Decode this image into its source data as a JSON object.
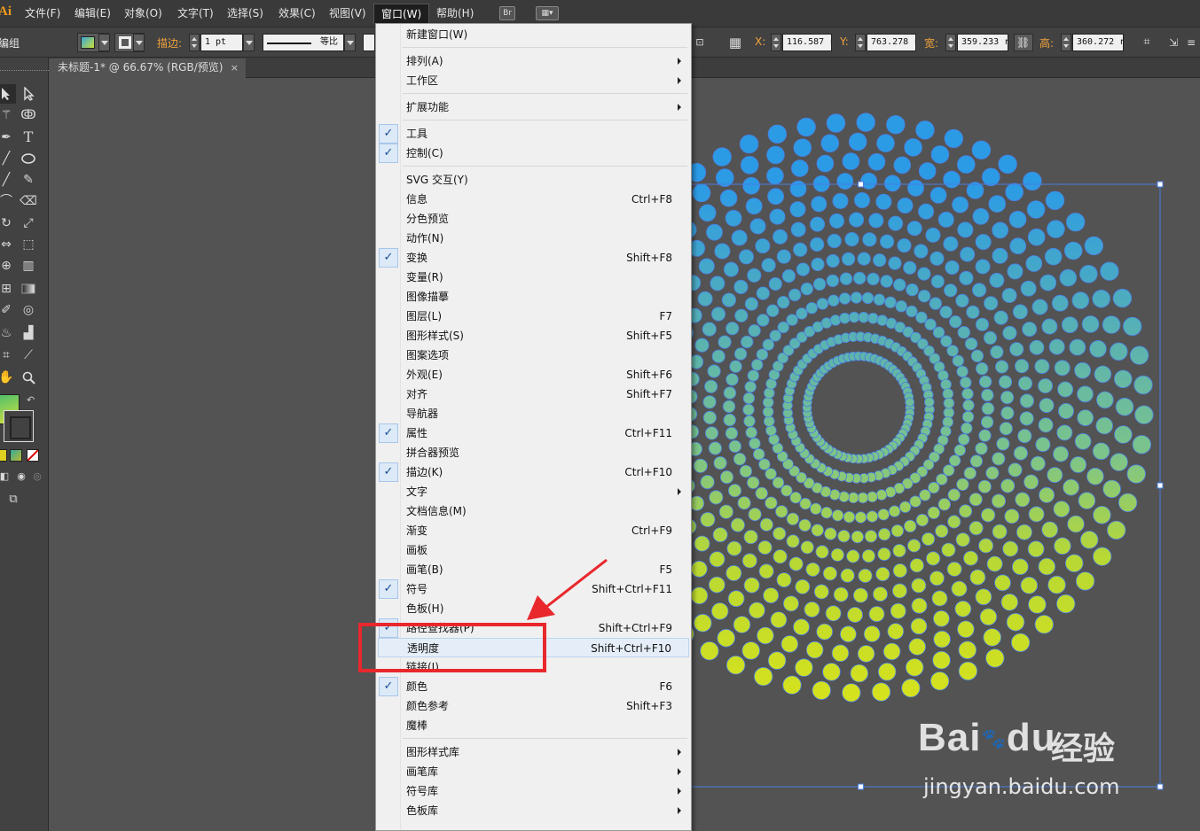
{
  "app": {
    "logo": "Ai",
    "colors": {
      "accent_orange": "#f29b1d",
      "menu_bg": "#f0f0f0",
      "annotation_red": "#e8282d",
      "selection_blue": "#4a7de1"
    }
  },
  "menubar": {
    "items": [
      {
        "label": "文件(F)"
      },
      {
        "label": "编辑(E)"
      },
      {
        "label": "对象(O)"
      },
      {
        "label": "文字(T)"
      },
      {
        "label": "选择(S)"
      },
      {
        "label": "效果(C)"
      },
      {
        "label": "视图(V)"
      },
      {
        "label": "窗口(W)",
        "active": true
      },
      {
        "label": "帮助(H)"
      }
    ],
    "bridge_label": "Br"
  },
  "controlbar": {
    "group_label": "编组",
    "stroke_label": "描边:",
    "stroke_weight": "1 pt",
    "stroke_profile": "等比",
    "x_label": "X:",
    "x_value": "116.587 r",
    "y_label": "Y:",
    "y_value": "763.278 r",
    "w_label": "宽:",
    "w_value": "359.233 r",
    "h_label": "高:",
    "h_value": "360.272 r"
  },
  "document": {
    "tab_title": "未标题-1* @ 66.67% (RGB/预览)",
    "close_glyph": "×"
  },
  "window_menu": {
    "items": [
      {
        "label": "新建窗口(W)",
        "shortcut": "",
        "submenu": false,
        "checked": false
      },
      {
        "sep": true
      },
      {
        "label": "排列(A)",
        "shortcut": "",
        "submenu": true,
        "checked": false
      },
      {
        "label": "工作区",
        "shortcut": "",
        "submenu": true,
        "checked": false
      },
      {
        "sep": true
      },
      {
        "label": "扩展功能",
        "shortcut": "",
        "submenu": true,
        "checked": false
      },
      {
        "sep": true
      },
      {
        "label": "工具",
        "shortcut": "",
        "submenu": false,
        "checked": true
      },
      {
        "label": "控制(C)",
        "shortcut": "",
        "submenu": false,
        "checked": true
      },
      {
        "sep": true
      },
      {
        "label": "SVG 交互(Y)",
        "shortcut": "",
        "submenu": false,
        "checked": false
      },
      {
        "label": "信息",
        "shortcut": "Ctrl+F8",
        "submenu": false,
        "checked": false
      },
      {
        "label": "分色预览",
        "shortcut": "",
        "submenu": false,
        "checked": false
      },
      {
        "label": "动作(N)",
        "shortcut": "",
        "submenu": false,
        "checked": false
      },
      {
        "label": "变换",
        "shortcut": "Shift+F8",
        "submenu": false,
        "checked": true
      },
      {
        "label": "变量(R)",
        "shortcut": "",
        "submenu": false,
        "checked": false
      },
      {
        "label": "图像描摹",
        "shortcut": "",
        "submenu": false,
        "checked": false
      },
      {
        "label": "图层(L)",
        "shortcut": "F7",
        "submenu": false,
        "checked": false
      },
      {
        "label": "图形样式(S)",
        "shortcut": "Shift+F5",
        "submenu": false,
        "checked": false
      },
      {
        "label": "图案选项",
        "shortcut": "",
        "submenu": false,
        "checked": false
      },
      {
        "label": "外观(E)",
        "shortcut": "Shift+F6",
        "submenu": false,
        "checked": false
      },
      {
        "label": "对齐",
        "shortcut": "Shift+F7",
        "submenu": false,
        "checked": false
      },
      {
        "label": "导航器",
        "shortcut": "",
        "submenu": false,
        "checked": false
      },
      {
        "label": "属性",
        "shortcut": "Ctrl+F11",
        "submenu": false,
        "checked": true
      },
      {
        "label": "拼合器预览",
        "shortcut": "",
        "submenu": false,
        "checked": false
      },
      {
        "label": "描边(K)",
        "shortcut": "Ctrl+F10",
        "submenu": false,
        "checked": true
      },
      {
        "label": "文字",
        "shortcut": "",
        "submenu": true,
        "checked": false
      },
      {
        "label": "文档信息(M)",
        "shortcut": "",
        "submenu": false,
        "checked": false
      },
      {
        "label": "渐变",
        "shortcut": "Ctrl+F9",
        "submenu": false,
        "checked": false
      },
      {
        "label": "画板",
        "shortcut": "",
        "submenu": false,
        "checked": false
      },
      {
        "label": "画笔(B)",
        "shortcut": "F5",
        "submenu": false,
        "checked": false
      },
      {
        "label": "符号",
        "shortcut": "Shift+Ctrl+F11",
        "submenu": false,
        "checked": true
      },
      {
        "label": "色板(H)",
        "shortcut": "",
        "submenu": false,
        "checked": false
      },
      {
        "label": "路径查找器(P)",
        "shortcut": "Shift+Ctrl+F9",
        "submenu": false,
        "checked": true
      },
      {
        "label": "透明度",
        "shortcut": "Shift+Ctrl+F10",
        "submenu": false,
        "checked": false,
        "highlighted": true
      },
      {
        "label": "链接(I)",
        "shortcut": "",
        "submenu": false,
        "checked": false
      },
      {
        "label": "颜色",
        "shortcut": "F6",
        "submenu": false,
        "checked": true
      },
      {
        "label": "颜色参考",
        "shortcut": "Shift+F3",
        "submenu": false,
        "checked": false
      },
      {
        "label": "魔棒",
        "shortcut": "",
        "submenu": false,
        "checked": false
      },
      {
        "sep": true
      },
      {
        "label": "图形样式库",
        "shortcut": "",
        "submenu": true,
        "checked": false
      },
      {
        "label": "画笔库",
        "shortcut": "",
        "submenu": true,
        "checked": false
      },
      {
        "label": "符号库",
        "shortcut": "",
        "submenu": true,
        "checked": false
      },
      {
        "label": "色板库",
        "shortcut": "",
        "submenu": true,
        "checked": false
      }
    ],
    "check_glyph": "✓"
  },
  "watermark": {
    "brand": "Bai",
    "brand_tail": "du",
    "cn": "经验",
    "url": "jingyan.baidu.com"
  }
}
